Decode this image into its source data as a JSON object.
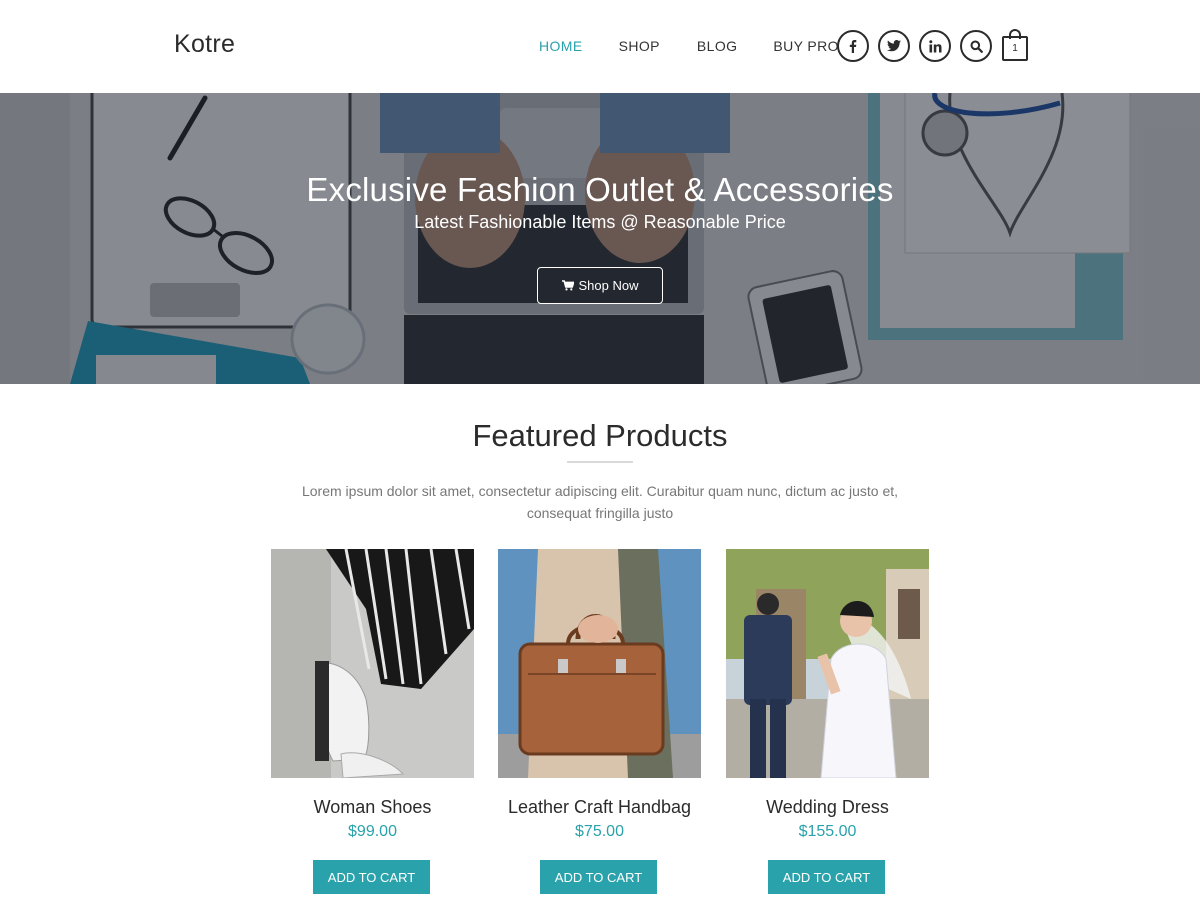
{
  "brand": {
    "logo": "Kotre"
  },
  "nav": {
    "items": [
      "HOME",
      "SHOP",
      "BLOG",
      "BUY PRO"
    ],
    "active": "HOME"
  },
  "header_icons": [
    "facebook-icon",
    "twitter-icon",
    "linkedin-icon",
    "search-icon"
  ],
  "cart": {
    "count": "1"
  },
  "hero": {
    "title": "Exclusive Fashion Outlet & Accessories",
    "subtitle": "Latest Fashionable Items @ Reasonable Price",
    "button": "Shop Now"
  },
  "featured": {
    "title": "Featured Products",
    "description": "Lorem ipsum dolor sit amet, consectetur adipiscing elit. Curabitur quam nunc, dictum ac justo et, consequat fringilla justo",
    "products": [
      {
        "name": "Woman Shoes",
        "price": "$99.00",
        "button": "ADD TO CART"
      },
      {
        "name": "Leather Craft Handbag",
        "price": "$75.00",
        "button": "ADD TO CART"
      },
      {
        "name": "Wedding Dress",
        "price": "$155.00",
        "button": "ADD TO CART"
      }
    ]
  },
  "colors": {
    "accent": "#2aa2ab",
    "text": "#2b2b2b",
    "muted": "#777777"
  }
}
